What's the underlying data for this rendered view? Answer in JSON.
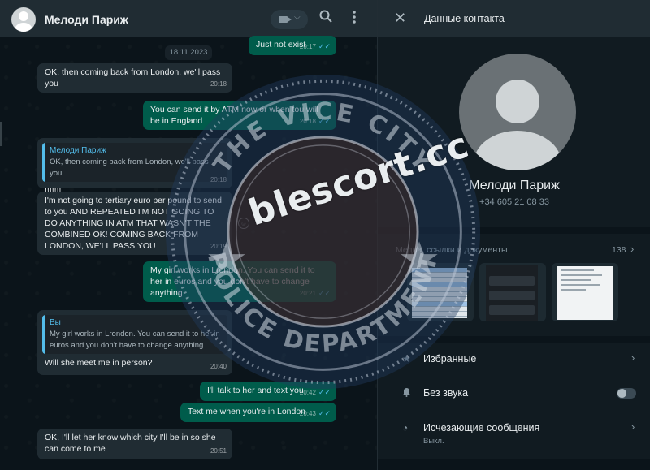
{
  "header": {
    "contact_name": "Мелоди Париж",
    "icons": {
      "video": "video-call-icon",
      "search": "search-icon",
      "menu": "more-menu-icon"
    }
  },
  "chat": {
    "date_chip": "18.11.2023",
    "messages": [
      {
        "dir": "out",
        "text": "Just not exist",
        "time": "20:17"
      },
      {
        "dir": "in",
        "text": "OK, then coming back from London, we'll pass you",
        "time": "20:18"
      },
      {
        "dir": "out",
        "text": "You can send it by ATM now or when tou will be in England",
        "time": "20:18"
      },
      {
        "dir": "in",
        "quote_name": "Мелоди Париж",
        "quote_text": "OK, then coming back from London, we'll pass you",
        "text": "!!!!!!!",
        "time": "20:18"
      },
      {
        "dir": "in",
        "text": "I'm not going to tertiary euro per pound to send to you AND REPEATED I'M NOT GOING TO DO ANYTHING IN ATM THAT WASN'T THE COMBINED OK! COMING BACK FROM LONDON, WE'LL PASS YOU",
        "time": "20:19"
      },
      {
        "dir": "out",
        "text": "My girl works in Lrondon. You can send it to her in euros and you don't have to change anything.",
        "time": "20:21"
      },
      {
        "dir": "in",
        "quote_name": "Вы",
        "quote_text": "My girl works in Lrondon. You can send it to her in euros and you don't have to change anything.",
        "text": "Will she meet me in person?",
        "time": "20:40"
      },
      {
        "dir": "out",
        "text": "I'll talk to her and text you",
        "time": "20:42"
      },
      {
        "dir": "out",
        "text": "Text me when you're in London",
        "time": "20:43"
      },
      {
        "dir": "in",
        "text": "OK, I'll let her know which city I'll be in so she can come to me",
        "time": "20:51"
      }
    ]
  },
  "panel": {
    "title": "Данные контакта",
    "name": "Мелоди Париж",
    "phone": "+34 605 21 08 33",
    "media_label": "Медиа, ссылки и документы",
    "media_count": "138",
    "options": [
      {
        "label": "Избранные",
        "icon": "star-icon"
      },
      {
        "label": "Без звука",
        "icon": "bell-icon"
      },
      {
        "label": "Исчезающие сообщения",
        "sub": "Выкл.",
        "icon": "timer-icon"
      }
    ]
  },
  "watermark": {
    "text": "blescort.cc",
    "seal_top": "THE VICE CITY",
    "seal_bottom": "POLICE DEPARTMENT"
  },
  "colors": {
    "chat_bg": "#0b141a",
    "incoming": "#202c33",
    "outgoing": "#005c4b",
    "accent": "#53bdeb",
    "panel_bg": "#111b21"
  }
}
